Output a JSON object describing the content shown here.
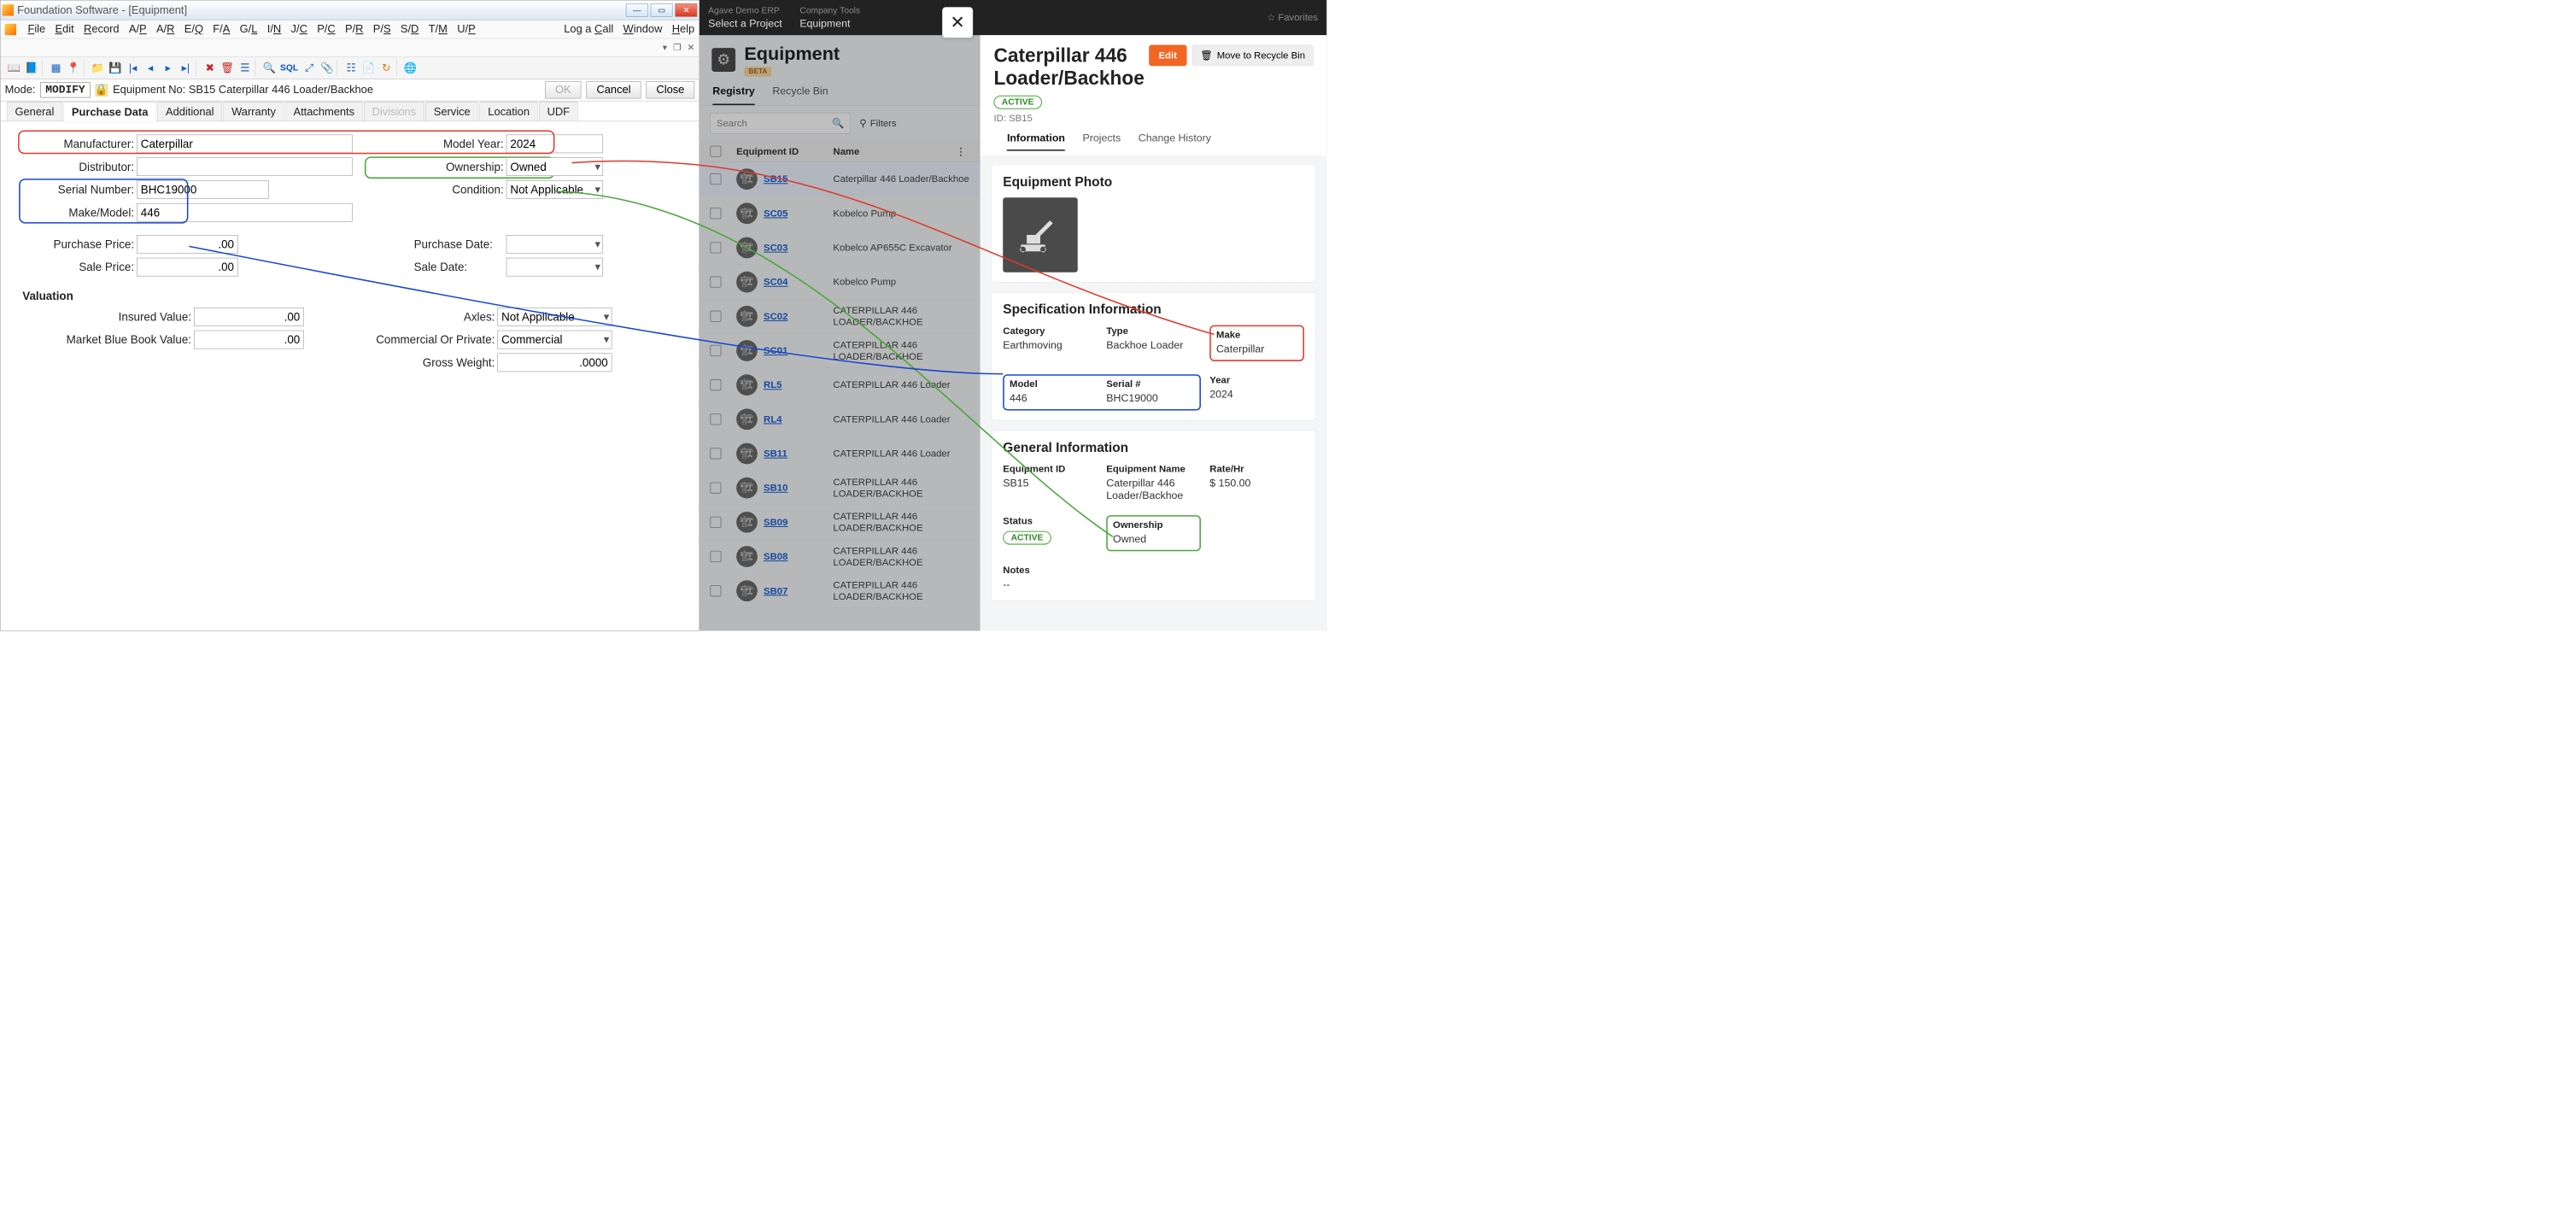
{
  "fs": {
    "title": "Foundation Software - [Equipment]",
    "menu": [
      "File",
      "Edit",
      "Record",
      "A/P",
      "A/R",
      "E/Q",
      "F/A",
      "G/L",
      "I/N",
      "J/C",
      "P/C",
      "P/R",
      "P/S",
      "S/D",
      "T/M",
      "U/P"
    ],
    "menu_right": [
      "Log a Call",
      "Window",
      "Help"
    ],
    "modebar": {
      "mode_label": "Mode:",
      "mode": "MODIFY",
      "equip_label": "Equipment No: SB15  Caterpillar 446 Loader/Backhoe",
      "ok": "OK",
      "cancel": "Cancel",
      "close": "Close"
    },
    "tabs": [
      "General",
      "Purchase Data",
      "Additional",
      "Warranty",
      "Attachments",
      "Divisions",
      "Service",
      "Location",
      "UDF"
    ],
    "active_tab": "Purchase Data",
    "form": {
      "manufacturer_l": "Manufacturer:",
      "manufacturer": "Caterpillar",
      "modelyear_l": "Model Year:",
      "modelyear": "2024",
      "distributor_l": "Distributor:",
      "distributor": "",
      "ownership_l": "Ownership:",
      "ownership": "Owned",
      "serial_l": "Serial Number:",
      "serial": "BHC19000",
      "condition_l": "Condition:",
      "condition": "Not Applicable",
      "makemodel_l": "Make/Model:",
      "makemodel": "446",
      "pprice_l": "Purchase Price:",
      "pprice": ".00",
      "pdate_l": "Purchase Date:",
      "pdate": "",
      "sprice_l": "Sale Price:",
      "sprice": ".00",
      "sdate_l": "Sale Date:",
      "sdate": "",
      "valuation_h": "Valuation",
      "insured_l": "Insured Value:",
      "insured": ".00",
      "mbbv_l": "Market Blue Book Value:",
      "mbbv": ".00",
      "axles_l": "Axles:",
      "axles": "Not Applicable",
      "cop_l": "Commercial Or Private:",
      "cop": "Commercial",
      "gw_l": "Gross Weight:",
      "gw": ".0000"
    }
  },
  "ag": {
    "top": {
      "proj_l": "Agave Demo ERP",
      "proj_v": "Select a Project",
      "tools_l": "Company Tools",
      "tools_v": "Equipment",
      "fav": "Favorites"
    },
    "header": {
      "title": "Equipment",
      "beta": "BETA"
    },
    "subtabs": [
      "Registry",
      "Recycle Bin"
    ],
    "search_placeholder": "Search",
    "filters_label": "Filters",
    "thead": {
      "id": "Equipment ID",
      "name": "Name"
    },
    "rows": [
      {
        "id": "SB15",
        "name": "Caterpillar 446 Loader/Backhoe",
        "sel": true
      },
      {
        "id": "SC05",
        "name": "Kobelco Pump"
      },
      {
        "id": "SC03",
        "name": "Kobelco AP655C Excavator"
      },
      {
        "id": "SC04",
        "name": "Kobelco Pump"
      },
      {
        "id": "SC02",
        "name": "CATERPILLAR 446 LOADER/BACKHOE"
      },
      {
        "id": "SC01",
        "name": "CATERPILLAR 446 LOADER/BACKHOE"
      },
      {
        "id": "RL5",
        "name": "CATERPILLAR 446 Loader"
      },
      {
        "id": "RL4",
        "name": "CATERPILLAR 446 Loader"
      },
      {
        "id": "SB11",
        "name": "CATERPILLAR 446 Loader"
      },
      {
        "id": "SB10",
        "name": "CATERPILLAR 446 LOADER/BACKHOE"
      },
      {
        "id": "SB09",
        "name": "CATERPILLAR 446 LOADER/BACKHOE"
      },
      {
        "id": "SB08",
        "name": "CATERPILLAR 446 LOADER/BACKHOE"
      },
      {
        "id": "SB07",
        "name": "CATERPILLAR 446 LOADER/BACKHOE"
      }
    ]
  },
  "panel": {
    "title": "Caterpillar 446 Loader/Backhoe",
    "edit": "Edit",
    "recycle": "Move to Recycle Bin",
    "status": "ACTIVE",
    "idline": "ID: SB15",
    "tabs": [
      "Information",
      "Projects",
      "Change History"
    ],
    "photo_h": "Equipment Photo",
    "spec_h": "Specification Information",
    "spec": {
      "cat_l": "Category",
      "cat": "Earthmoving",
      "type_l": "Type",
      "type": "Backhoe Loader",
      "make_l": "Make",
      "make": "Caterpillar",
      "model_l": "Model",
      "model": "446",
      "serial_l": "Serial #",
      "serial": "BHC19000",
      "year_l": "Year",
      "year": "2024"
    },
    "gen_h": "General Information",
    "gen": {
      "id_l": "Equipment ID",
      "id": "SB15",
      "name_l": "Equipment Name",
      "name": "Caterpillar 446 Loader/Backhoe",
      "rate_l": "Rate/Hr",
      "rate": "$ 150.00",
      "status_l": "Status",
      "status": "ACTIVE",
      "own_l": "Ownership",
      "own": "Owned",
      "notes_l": "Notes",
      "notes": "--"
    }
  }
}
